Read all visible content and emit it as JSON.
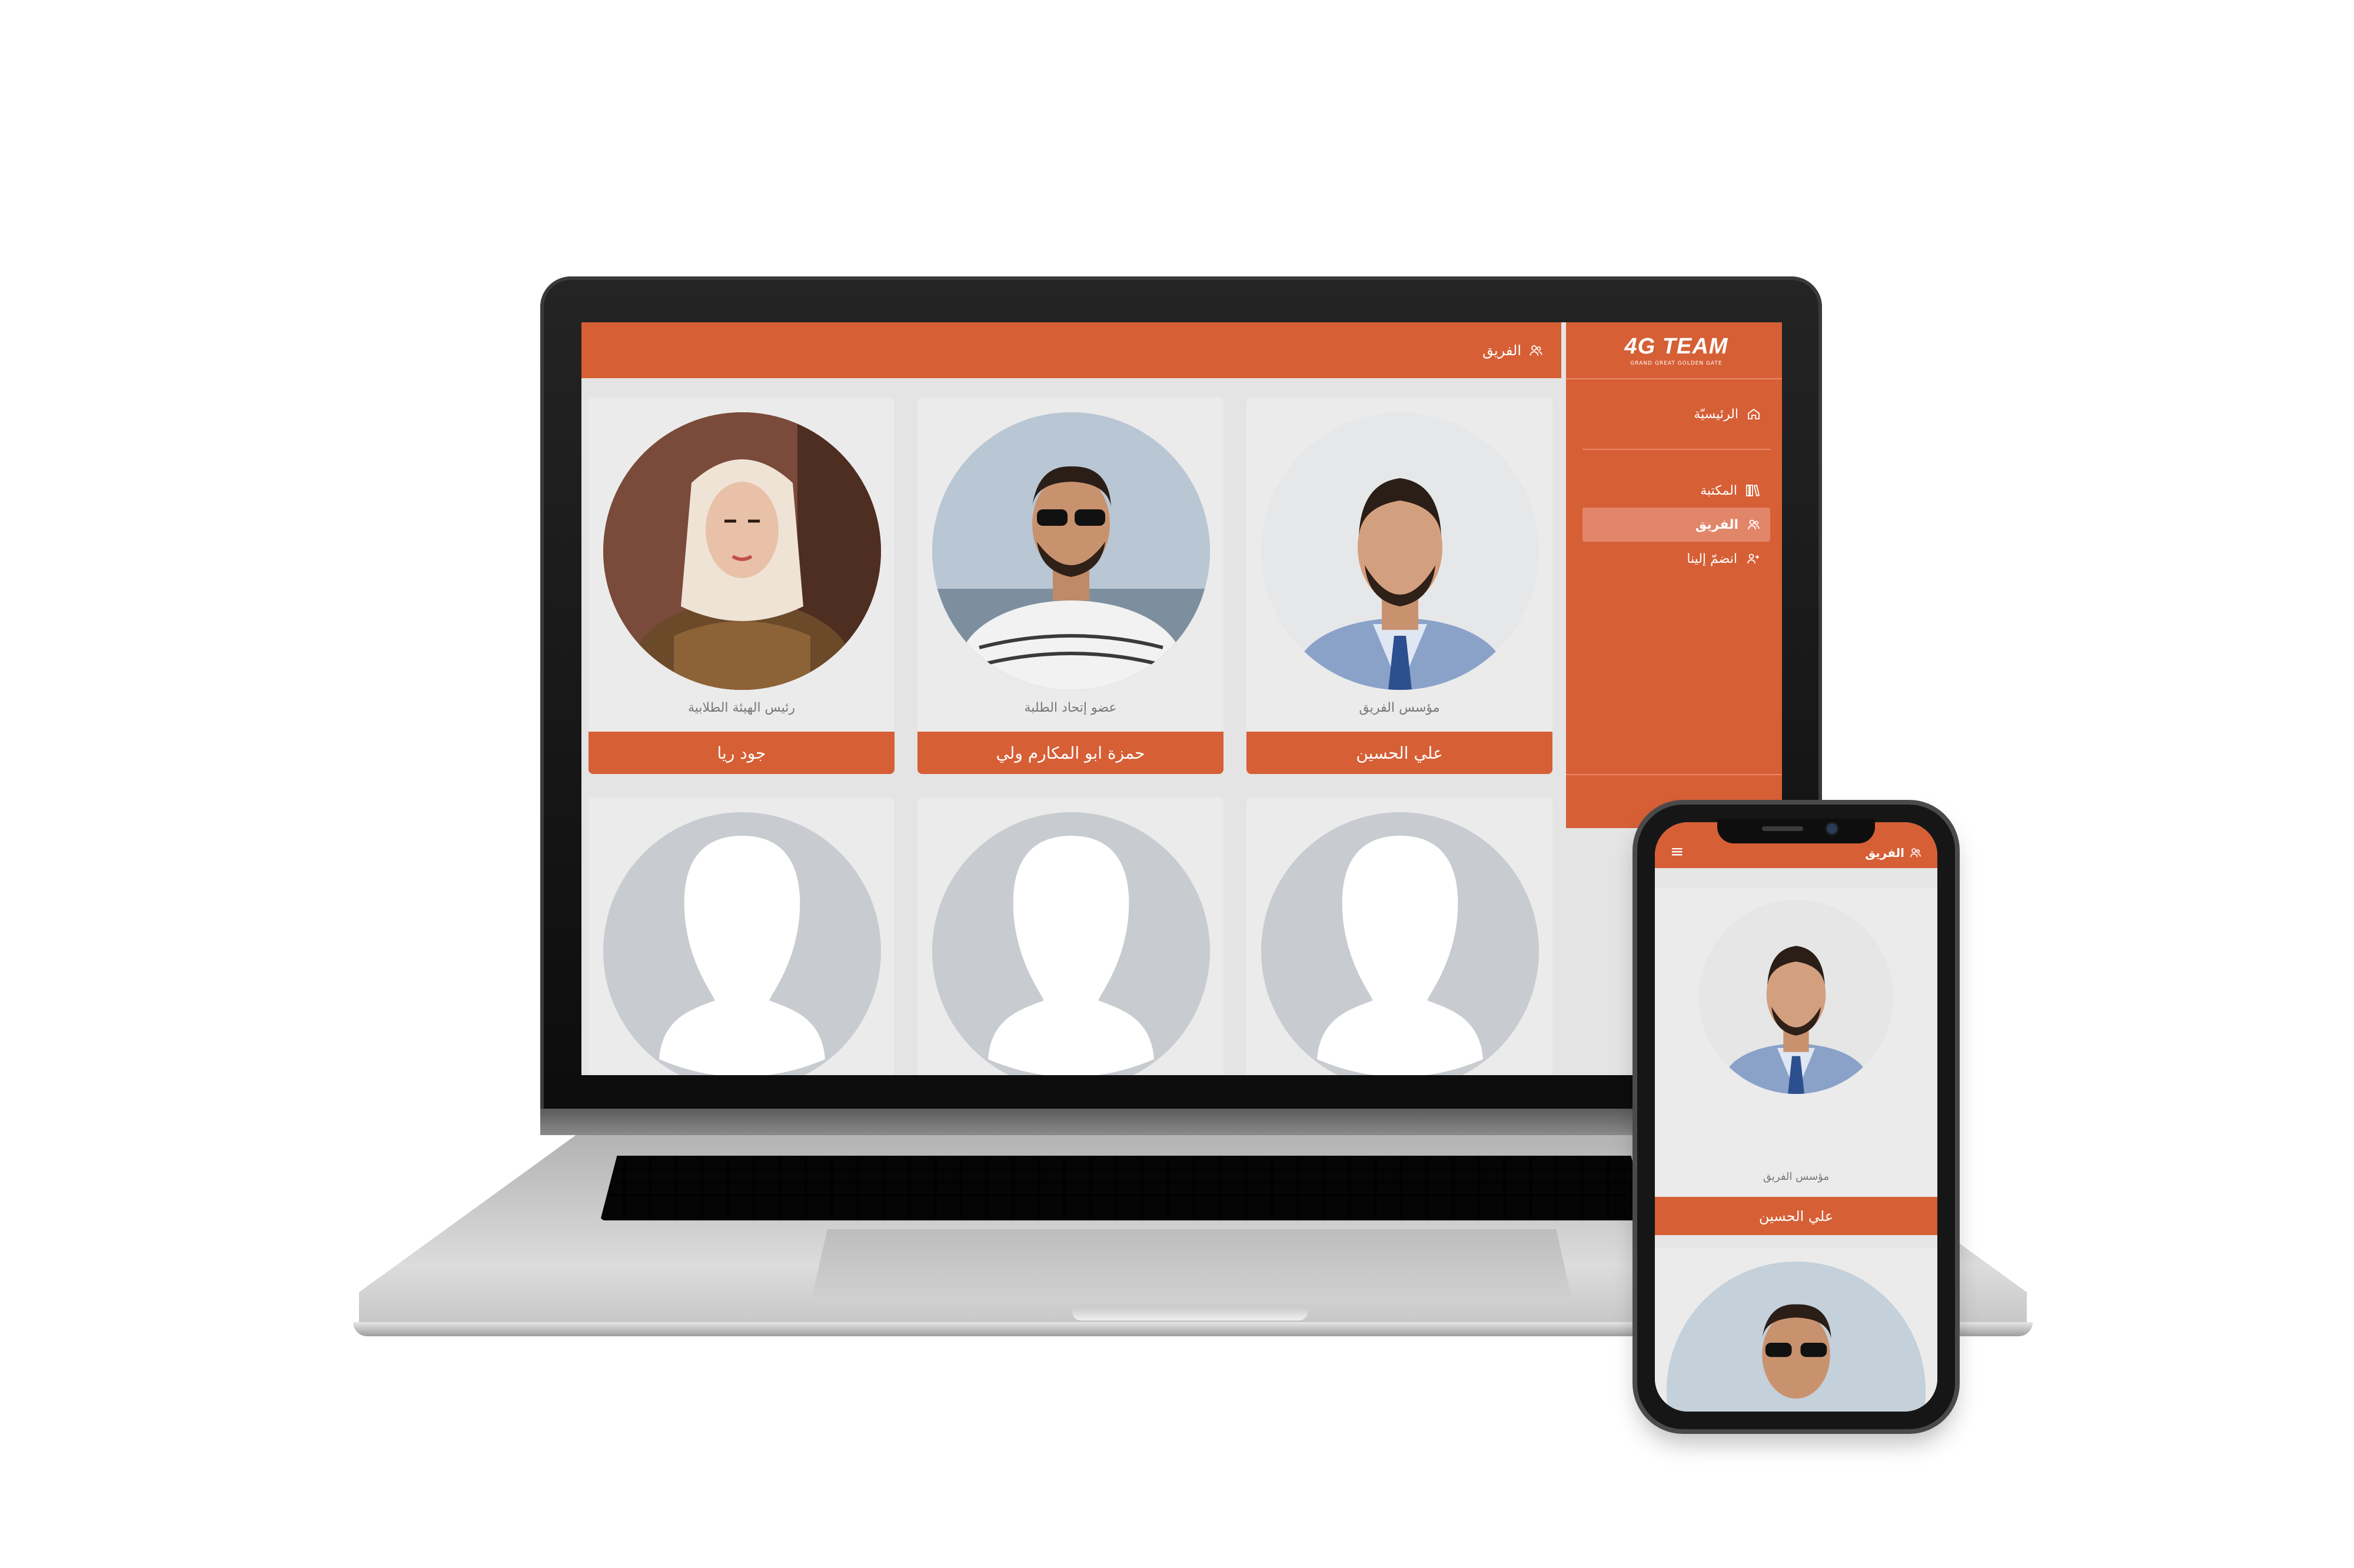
{
  "topbar": {
    "title": "الفريق",
    "icon": "team-icon"
  },
  "sidebar": {
    "logo": {
      "main": "4G TEAM",
      "tagline": "GRAND GREAT GOLDEN GATE"
    },
    "items": [
      {
        "label": "الرئيسيّة",
        "icon": "home-icon"
      },
      {
        "label": "المكتبة",
        "icon": "library-icon"
      },
      {
        "label": "الفريق",
        "icon": "team-icon",
        "active": true
      },
      {
        "label": "انضمّ إلينا",
        "icon": "add-user-icon"
      }
    ]
  },
  "members": [
    {
      "name": "علي الحسين",
      "role": "مؤسس الفريق"
    },
    {
      "name": "حمزة ابو المكارم ولي",
      "role": "عضو إتحاد الطلبة"
    },
    {
      "name": "جود ريا",
      "role": "رئيس الهيئة الطلابية"
    }
  ],
  "phone": {
    "title": "الفريق",
    "menu_icon": "≡",
    "member": {
      "name": "علي الحسين",
      "role": "مؤسس الفريق"
    }
  },
  "colors": {
    "accent": "#d65f36",
    "accent_light": "#e2866a",
    "card": "#ebebeb",
    "page": "#e4e4e4"
  }
}
